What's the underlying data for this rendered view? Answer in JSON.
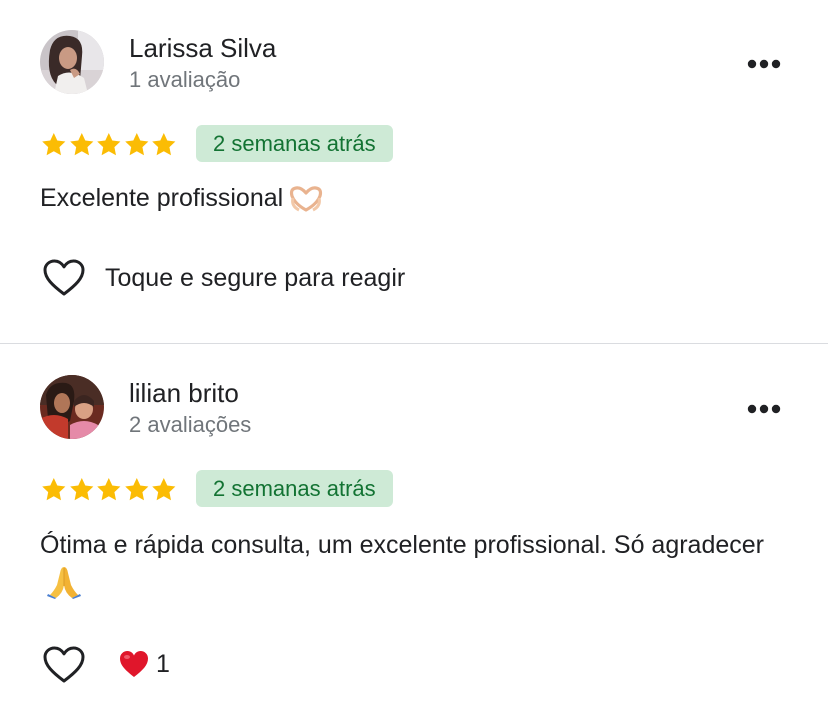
{
  "colors": {
    "star": "#fbbc04",
    "badge_bg": "#ceead6",
    "badge_text": "#137333",
    "secondary_text": "#70757a",
    "divider": "#dadce0"
  },
  "reviews": [
    {
      "name": "Larissa Silva",
      "review_count": "1 avaliação",
      "rating": 5,
      "date": "2 semanas atrás",
      "text": "Excelente profissional",
      "text_emoji": "heart-hands-emoji",
      "react_prompt": "Toque e segure para reagir",
      "more_icon": "more-horizontal-icon"
    },
    {
      "name": "lilian brito",
      "review_count": "2 avaliações",
      "rating": 5,
      "date": "2 semanas atrás",
      "text": "Ótima e rápida consulta, um excelente profissional. Só agradecer",
      "text_emoji": "folded-hands-emoji",
      "reaction_count": "1",
      "more_icon": "more-horizontal-icon"
    }
  ]
}
